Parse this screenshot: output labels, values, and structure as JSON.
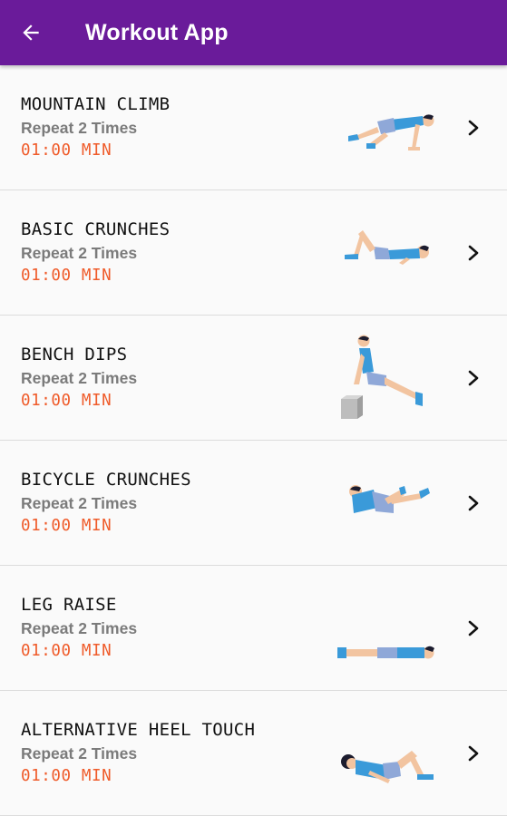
{
  "app_bar": {
    "title": "Workout App",
    "back_icon": "arrow-back-icon",
    "color": "#6a1b9a"
  },
  "exercises": [
    {
      "name": "MOUNTAIN CLIMB",
      "repeat": "Repeat 2 Times",
      "duration": "01:00 MIN",
      "illustration": "mountain-climb-figure-icon"
    },
    {
      "name": "BASIC CRUNCHES",
      "repeat": "Repeat 2 Times",
      "duration": "01:00 MIN",
      "illustration": "basic-crunches-figure-icon"
    },
    {
      "name": "BENCH DIPS",
      "repeat": "Repeat 2 Times",
      "duration": "01:00 MIN",
      "illustration": "bench-dips-figure-icon"
    },
    {
      "name": "BICYCLE CRUNCHES",
      "repeat": "Repeat 2 Times",
      "duration": "01:00 MIN",
      "illustration": "bicycle-crunches-figure-icon"
    },
    {
      "name": "LEG RAISE",
      "repeat": "Repeat 2 Times",
      "duration": "01:00 MIN",
      "illustration": "leg-raise-figure-icon"
    },
    {
      "name": "ALTERNATIVE HEEL TOUCH",
      "repeat": "Repeat 2 Times",
      "duration": "01:00 MIN",
      "illustration": "heel-touch-figure-icon"
    }
  ],
  "colors": {
    "duration_text": "#ef5b2a",
    "repeat_text": "#7b7b7b",
    "shirt": "#3a9ad9",
    "shorts": "#8fa8d8",
    "skin": "#f2c4a0",
    "hair": "#1c1c2e"
  }
}
